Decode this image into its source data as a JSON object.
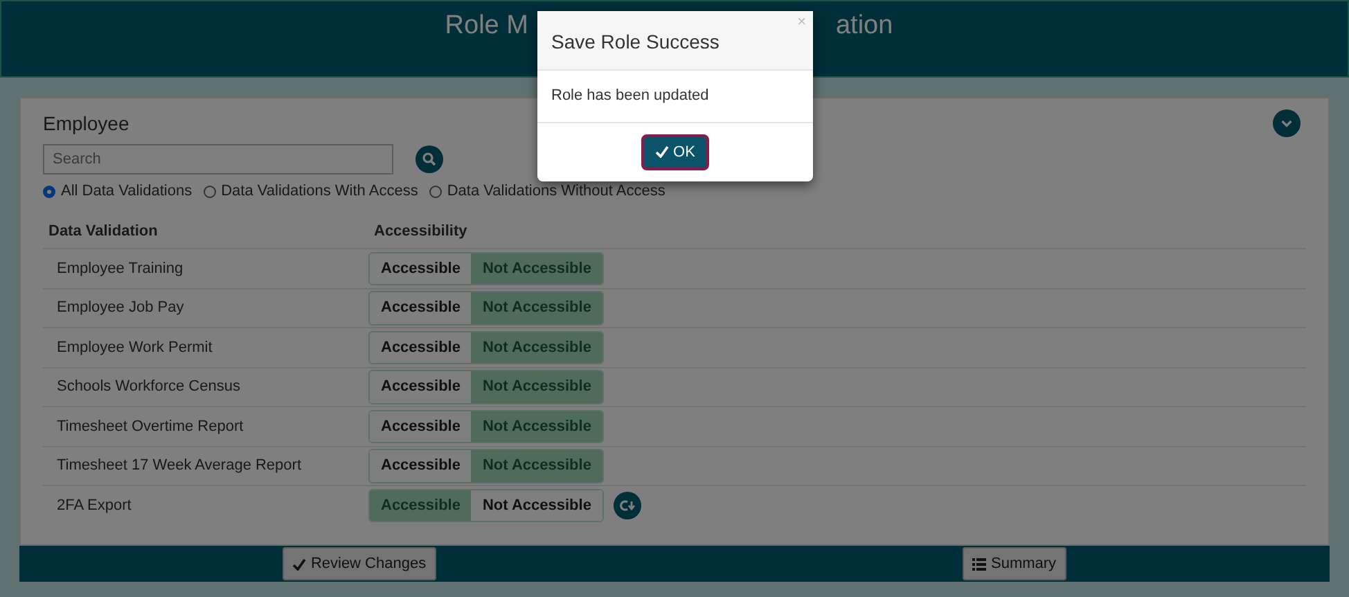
{
  "header": {
    "title_start": "Role M",
    "title_end": "ation"
  },
  "section": {
    "title": "Employee",
    "search": {
      "placeholder": "Search"
    },
    "filters": [
      {
        "label": "All Data Validations",
        "selected": true
      },
      {
        "label": "Data Validations With Access",
        "selected": false
      },
      {
        "label": "Data Validations Without Access",
        "selected": false
      }
    ]
  },
  "table": {
    "columns": [
      "Data Validation",
      "Accessibility"
    ],
    "rows": [
      {
        "name": "Employee Training",
        "changed": false,
        "options": [
          {
            "label": "Accessible",
            "selected": false
          },
          {
            "label": "Not Accessible",
            "selected": true
          }
        ]
      },
      {
        "name": "Employee Job Pay",
        "changed": false,
        "options": [
          {
            "label": "Accessible",
            "selected": false
          },
          {
            "label": "Not Accessible",
            "selected": true
          }
        ]
      },
      {
        "name": "Employee Work Permit",
        "changed": false,
        "options": [
          {
            "label": "Accessible",
            "selected": false
          },
          {
            "label": "Not Accessible",
            "selected": true
          }
        ]
      },
      {
        "name": "Schools Workforce Census",
        "changed": false,
        "options": [
          {
            "label": "Accessible",
            "selected": false
          },
          {
            "label": "Not Accessible",
            "selected": true
          }
        ]
      },
      {
        "name": "Timesheet Overtime Report",
        "changed": false,
        "options": [
          {
            "label": "Accessible",
            "selected": false
          },
          {
            "label": "Not Accessible",
            "selected": true
          }
        ]
      },
      {
        "name": "Timesheet 17 Week Average Report",
        "changed": false,
        "options": [
          {
            "label": "Accessible",
            "selected": false
          },
          {
            "label": "Not Accessible",
            "selected": true
          }
        ]
      },
      {
        "name": "2FA Export",
        "changed": true,
        "options": [
          {
            "label": "Accessible",
            "selected": true
          },
          {
            "label": "Not Accessible",
            "selected": false
          }
        ]
      }
    ]
  },
  "footer": {
    "buttons": [
      {
        "label": "Review Changes",
        "kind": "check"
      },
      {
        "label": "Summary",
        "kind": "list"
      }
    ]
  },
  "dialog": {
    "title": "Save Role Success",
    "close": "×",
    "message": "Role has been updated",
    "button": "OK"
  }
}
